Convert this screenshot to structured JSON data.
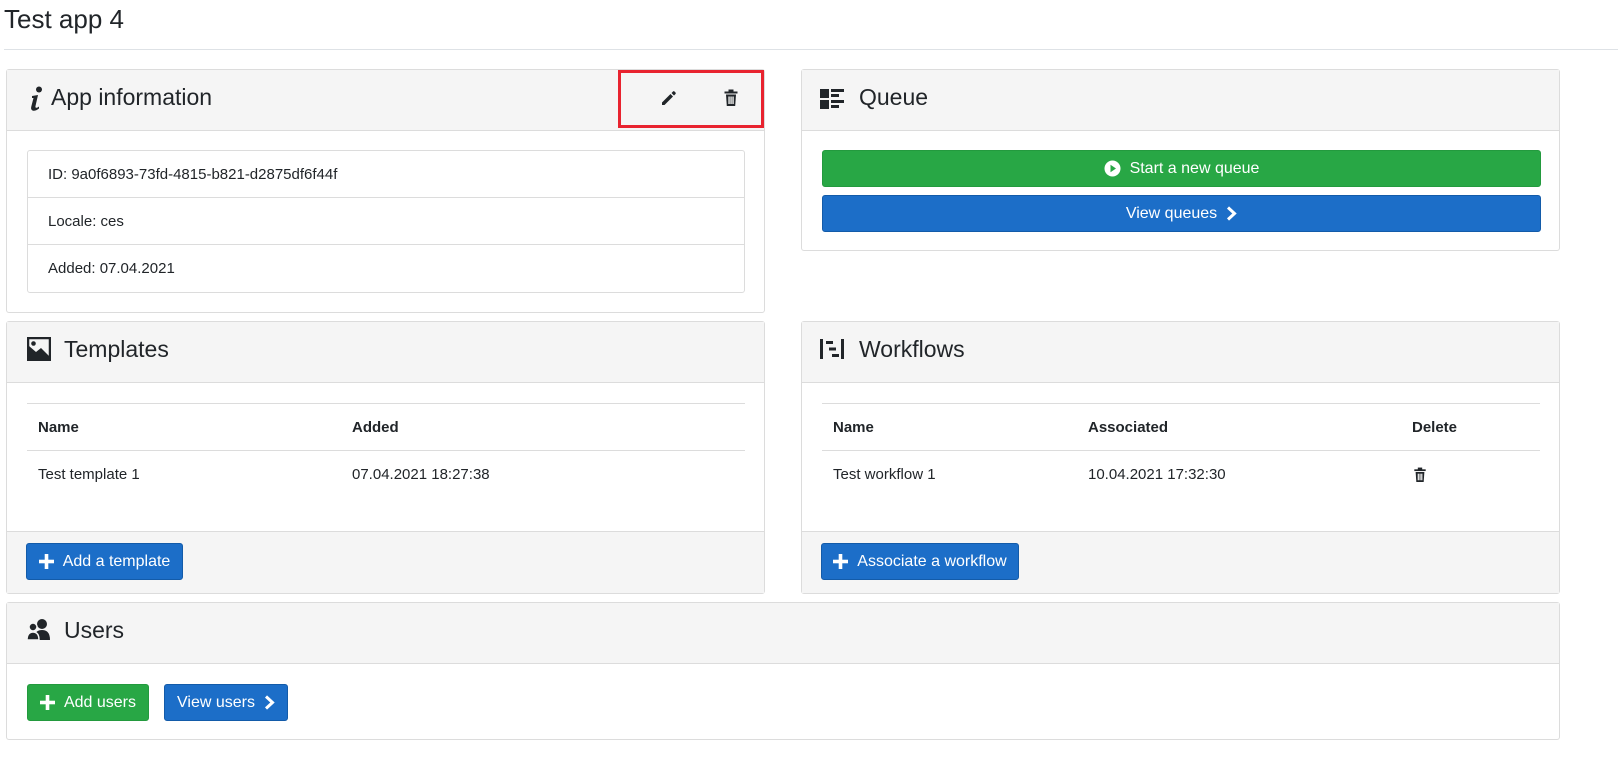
{
  "page": {
    "title": "Test app 4"
  },
  "app_info": {
    "title": "App information",
    "icon": "info-icon",
    "actions": {
      "edit_icon": "pencil-icon",
      "delete_icon": "trash-icon"
    },
    "items": [
      {
        "text": "ID: 9a0f6893-73fd-4815-b821-d2875df6f44f"
      },
      {
        "text": "Locale: ces"
      },
      {
        "text": "Added: 07.04.2021"
      }
    ]
  },
  "queue": {
    "title": "Queue",
    "icon": "queue-icon",
    "start_label": "Start a new queue",
    "view_label": "View queues"
  },
  "templates": {
    "title": "Templates",
    "icon": "image-icon",
    "columns": [
      "Name",
      "Added"
    ],
    "rows": [
      {
        "name": "Test template 1",
        "added": "07.04.2021 18:27:38"
      }
    ],
    "add_label": "Add a template"
  },
  "workflows": {
    "title": "Workflows",
    "icon": "workflow-icon",
    "columns": [
      "Name",
      "Associated",
      "Delete"
    ],
    "rows": [
      {
        "name": "Test workflow 1",
        "associated": "10.04.2021 17:32:30"
      }
    ],
    "associate_label": "Associate a workflow"
  },
  "users": {
    "title": "Users",
    "icon": "users-icon",
    "add_label": "Add users",
    "view_label": "View users"
  },
  "colors": {
    "green": "#28a745",
    "blue": "#1c6ec8",
    "highlight": "#e8232f"
  }
}
